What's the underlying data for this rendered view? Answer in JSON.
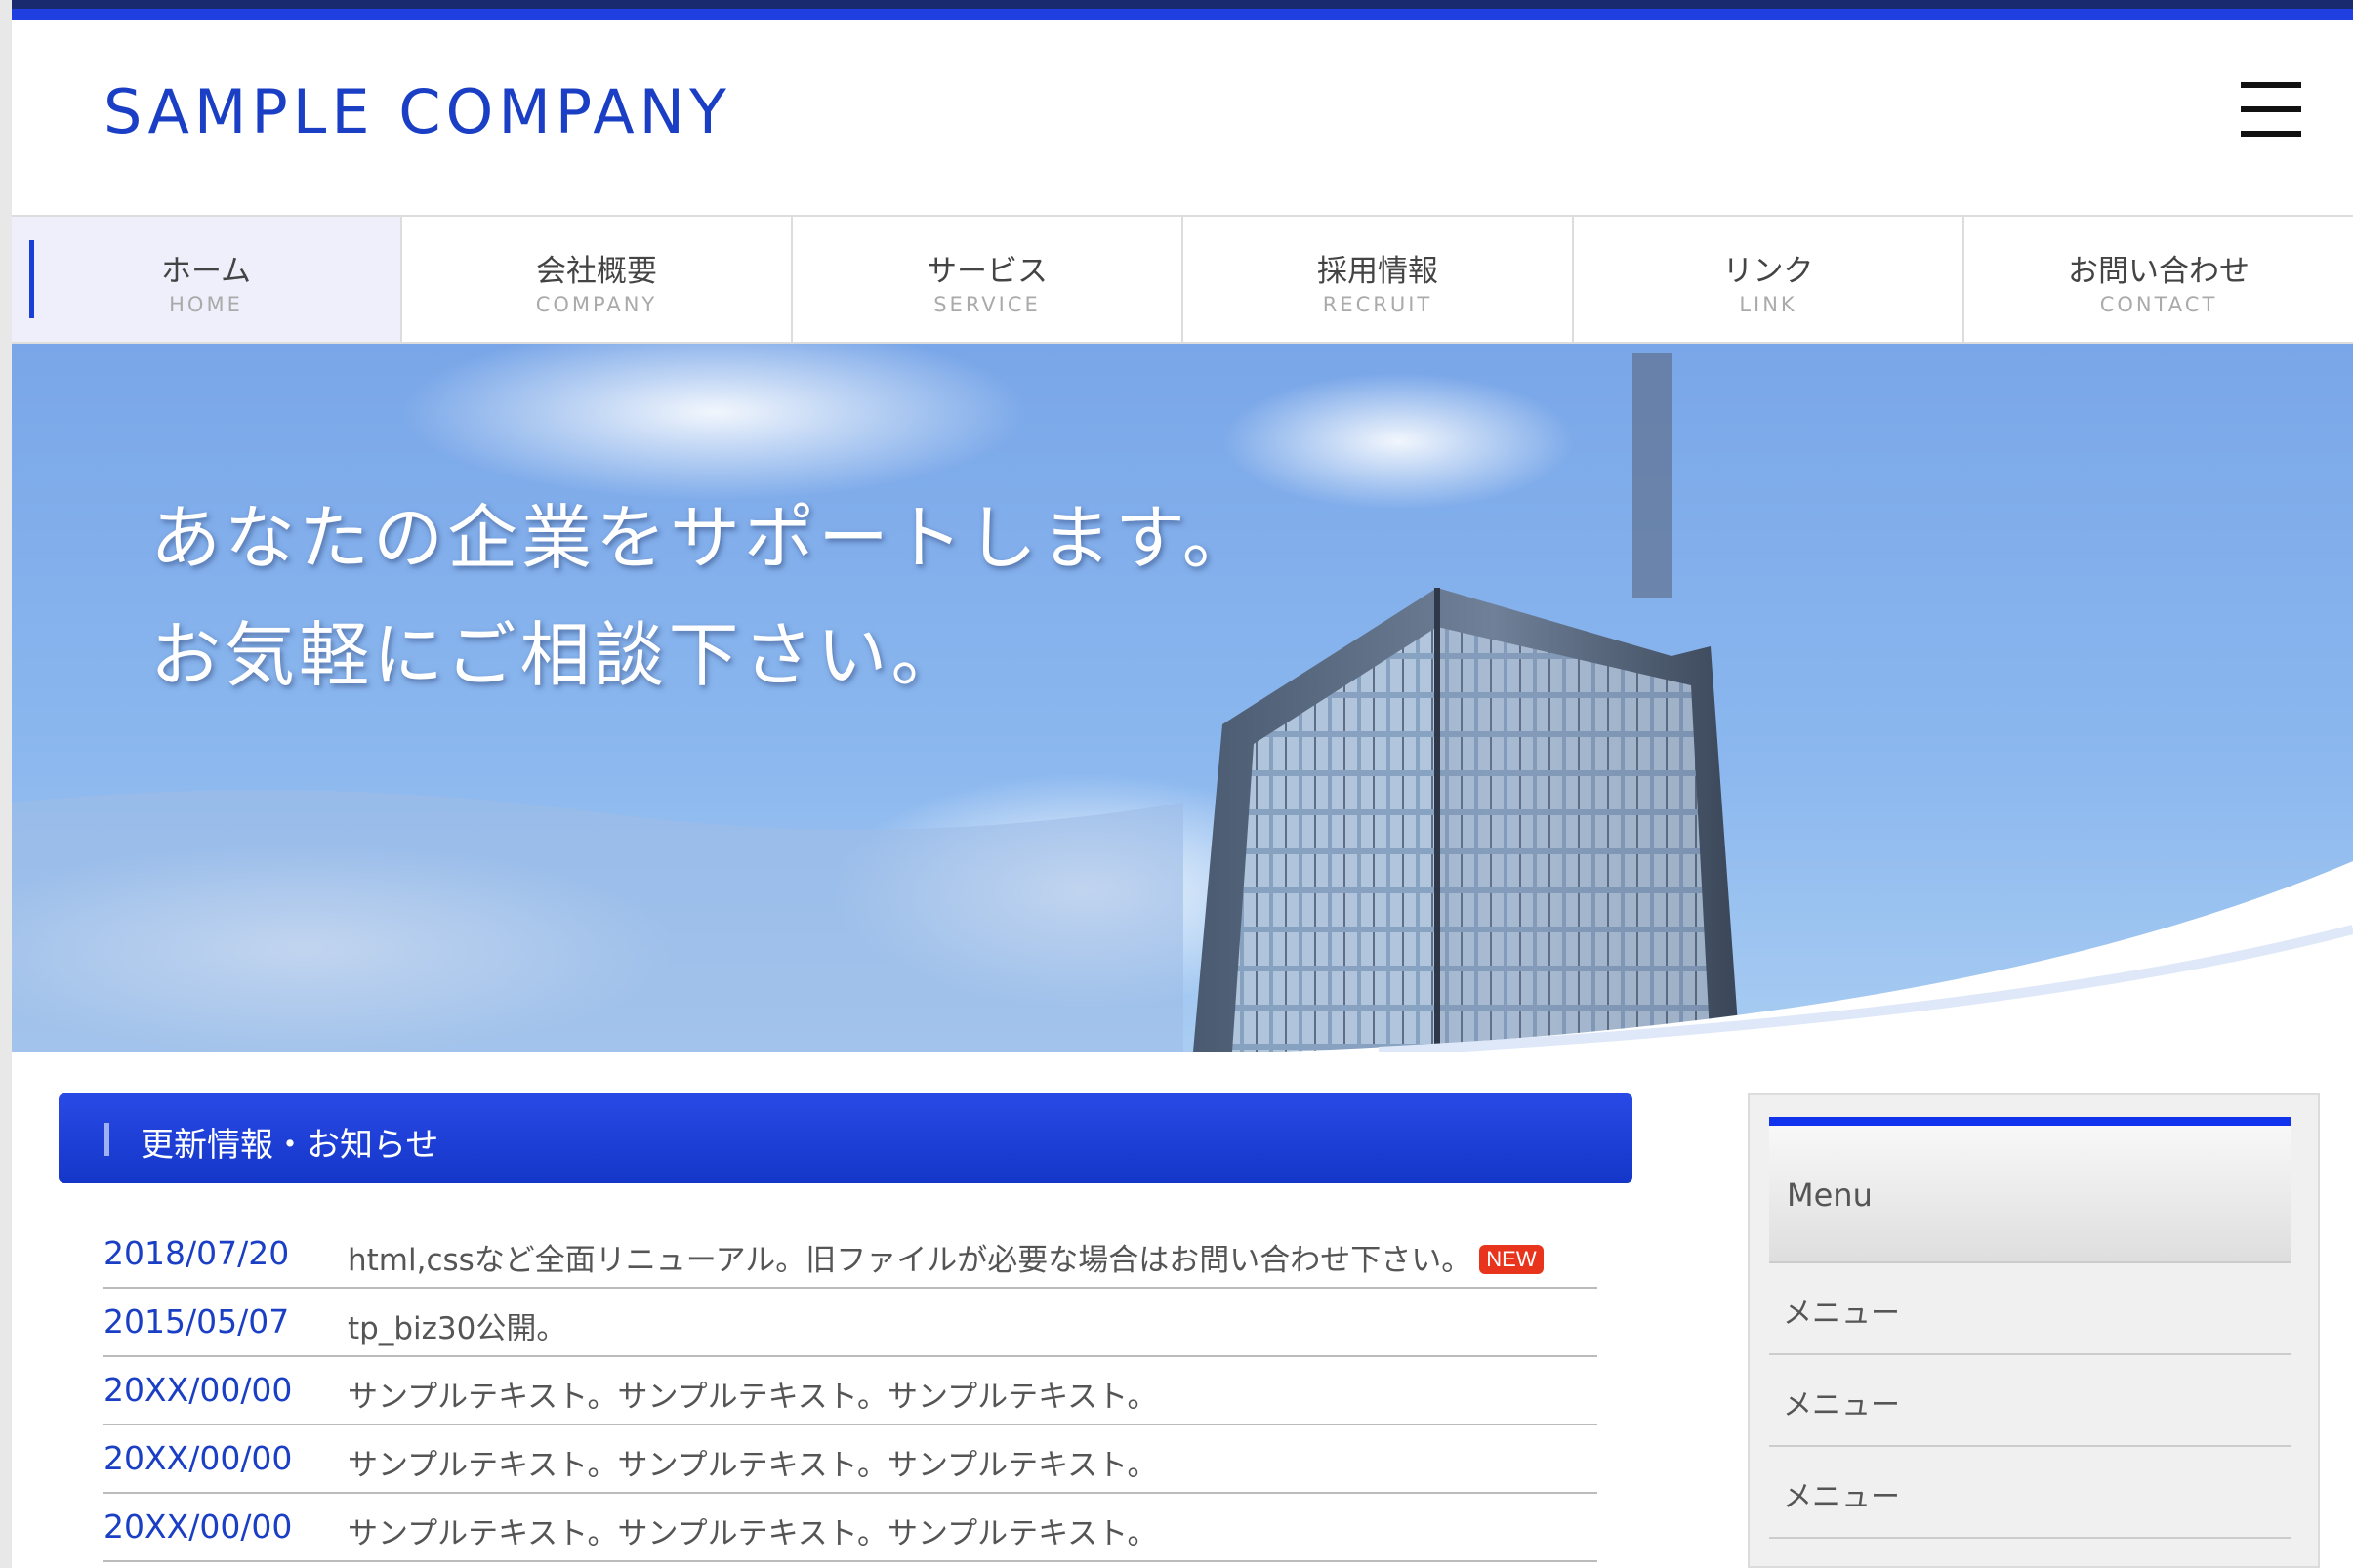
{
  "brand": {
    "logo_text": "SAMPLE COMPANY",
    "accent": "#1a3fc5",
    "bar_color": "#1f3fe0"
  },
  "header": {
    "menu_icon": "hamburger-icon"
  },
  "nav": {
    "items": [
      {
        "jp": "ホーム",
        "en": "HOME",
        "active": true
      },
      {
        "jp": "会社概要",
        "en": "COMPANY"
      },
      {
        "jp": "サービス",
        "en": "SERVICE"
      },
      {
        "jp": "採用情報",
        "en": "RECRUIT"
      },
      {
        "jp": "リンク",
        "en": "LINK"
      },
      {
        "jp": "お問い合わせ",
        "en": "CONTACT"
      }
    ]
  },
  "hero": {
    "line1": "あなたの企業をサポートします。",
    "line2": "お気軽にご相談下さい。"
  },
  "news": {
    "title": "更新情報・お知らせ",
    "new_badge": "NEW",
    "items": [
      {
        "date": "2018/07/20",
        "text": "html,cssなど全面リニューアル。旧ファイルが必要な場合はお問い合わせ下さい。"
      },
      {
        "date": "2015/05/07",
        "text": "tp_biz30公開。"
      },
      {
        "date": "20XX/00/00",
        "text": "サンプルテキスト。サンプルテキスト。サンプルテキスト。"
      },
      {
        "date": "20XX/00/00",
        "text": "サンプルテキスト。サンプルテキスト。サンプルテキスト。"
      },
      {
        "date": "20XX/00/00",
        "text": "サンプルテキスト。サンプルテキスト。サンプルテキスト。"
      }
    ]
  },
  "sidebar": {
    "heading": "Menu",
    "items": [
      {
        "label": "メニュー"
      },
      {
        "label": "メニュー"
      },
      {
        "label": "メニュー"
      }
    ]
  }
}
